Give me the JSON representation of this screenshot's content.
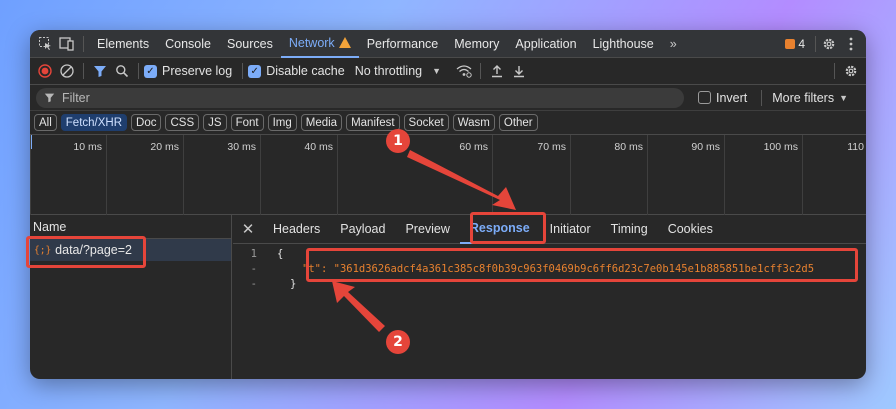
{
  "devtools": {
    "tabs": [
      {
        "label": "Elements"
      },
      {
        "label": "Console"
      },
      {
        "label": "Sources"
      },
      {
        "label": "Network"
      },
      {
        "label": "Performance"
      },
      {
        "label": "Memory"
      },
      {
        "label": "Application"
      },
      {
        "label": "Lighthouse"
      }
    ],
    "more_tabs": "»",
    "issues_count": "4",
    "toolbar": {
      "preserve_log": "Preserve log",
      "disable_cache": "Disable cache",
      "throttling": "No throttling"
    },
    "filter": {
      "placeholder": "Filter",
      "invert": "Invert",
      "more_filters": "More filters"
    },
    "type_filters": [
      "All",
      "Fetch/XHR",
      "Doc",
      "CSS",
      "JS",
      "Font",
      "Img",
      "Media",
      "Manifest",
      "Socket",
      "Wasm",
      "Other"
    ],
    "timeline_ticks": [
      "10 ms",
      "20 ms",
      "30 ms",
      "40 ms",
      "60 ms",
      "70 ms",
      "80 ms",
      "90 ms",
      "100 ms",
      "110"
    ],
    "name_column": "Name",
    "request": {
      "icon_text": "{;}",
      "name": "data/?page=2"
    },
    "detail_tabs": [
      {
        "label": "Headers"
      },
      {
        "label": "Payload"
      },
      {
        "label": "Preview"
      },
      {
        "label": "Response"
      },
      {
        "label": "Initiator"
      },
      {
        "label": "Timing"
      },
      {
        "label": "Cookies"
      }
    ],
    "response": {
      "line1_number": "1",
      "line2_number": "-",
      "line3_number": "-",
      "open_brace": "{",
      "key": "\"t\":",
      "value": "\"361d3626adcf4a361c385c8f0b39c963f0469b9c6ff6d23c7e0b145e1b885851be1cff3c2d5",
      "close_brace": "}"
    }
  },
  "annotations": {
    "step1": "1",
    "step2": "2",
    "color": "#e5453a"
  },
  "colors": {
    "accent": "#7cacf8",
    "warning": "#f2a33a",
    "xhr_orange": "#e8812f"
  }
}
